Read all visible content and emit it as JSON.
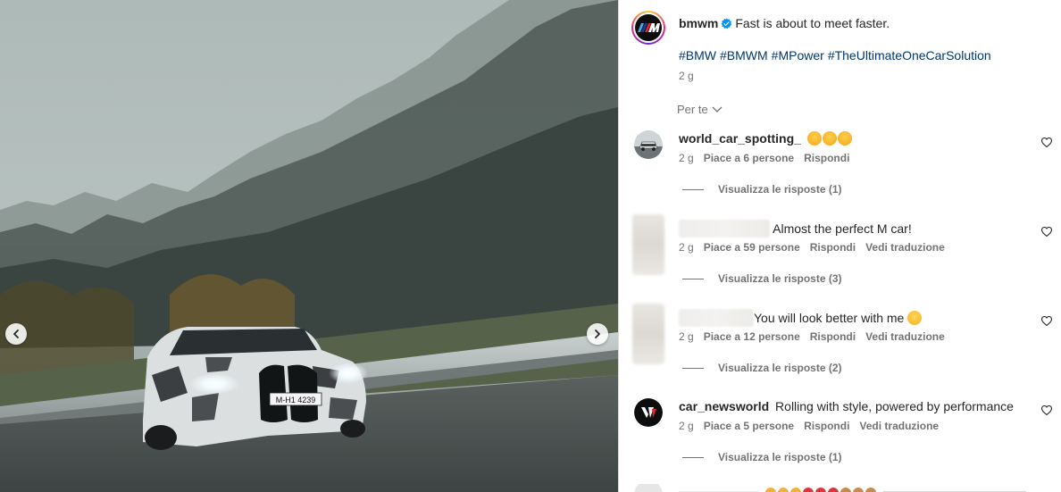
{
  "post": {
    "author": "bmwm",
    "caption": "Fast is about to meet faster.",
    "hashtags": [
      "#BMW",
      "#BMWM",
      "#MPower",
      "#TheUltimateOneCarSolution"
    ],
    "time": "2 g"
  },
  "photo": {
    "license_plate": "M-H1 4239"
  },
  "sort": {
    "label": "Per te"
  },
  "comments": [
    {
      "user": "world_car_spotting_",
      "text": "",
      "emojis": [
        "star-struck",
        "star-struck",
        "star-struck"
      ],
      "time": "2 g",
      "likes": "Piace a 6 persone",
      "reply": "Rispondi",
      "translate": "",
      "view_replies": "Visualizza le risposte (1)"
    },
    {
      "user": "",
      "text": "Almost the perfect M car!",
      "time": "2 g",
      "likes": "Piace a 59 persone",
      "reply": "Rispondi",
      "translate": "Vedi traduzione",
      "view_replies": "Visualizza le risposte (3)"
    },
    {
      "user": "",
      "text": "You will look better with me",
      "emojis": [
        "winking-face"
      ],
      "time": "2 g",
      "likes": "Piace a 12 persone",
      "reply": "Rispondi",
      "translate": "Vedi traduzione",
      "view_replies": "Visualizza le risposte (2)"
    },
    {
      "user": "car_newsworld",
      "text": "Rolling with style, powered by performance",
      "time": "2 g",
      "likes": "Piace a 5 persone",
      "reply": "Rispondi",
      "translate": "Vedi traduzione",
      "view_replies": "Visualizza le risposte (1)"
    }
  ],
  "colors": {
    "link": "#00376b",
    "muted": "#737373",
    "text": "#262626",
    "verified": "#0095f6"
  }
}
